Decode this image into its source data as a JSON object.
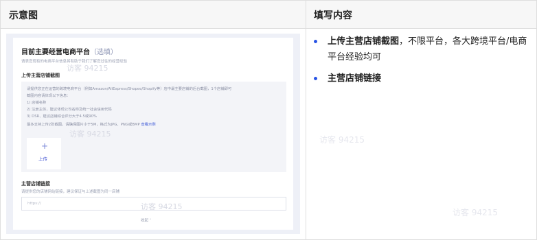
{
  "header": {
    "col1": "示意图",
    "col2": "填写内容"
  },
  "screenshot": {
    "title": "目前主要经营电商平台",
    "title_opt": "（选填）",
    "subtitle": "请表您现有的电商平台信息将有助于我们了解您过往的经营经验",
    "section1_title": "上传主营店铺截图",
    "instructions": [
      "请提供您正在运营的跨境电商平台（例如Amazon/AliExpress/Shopee/Shopify等）店中最主要店铺的后台截图，1个店铺即可",
      "截图内容请体现以下信息：",
      "1) 店铺名称",
      "2) 注册主体，建议体现公司名称及统一社会信用代码",
      "3) DSR、建议店铺综合评分大于4.5或90%",
      "最多支持上传2张截图，请确保图片小于5M，格式为JPG、PNG或BMP"
    ],
    "example_link": "查看示例",
    "upload_label": "上传",
    "section2_title": "主营店铺链接",
    "section2_sub": "请提供您的店铺网站链接，建议保证与上述截图为同一店铺",
    "input_placeholder": "https://",
    "collapse_label": "收起 ˄",
    "watermark": "访客 94215"
  },
  "content": {
    "item1_bold": "上传主营店铺截图",
    "item1_text": "，不限平台，各大跨境平台/电商平台经验均可",
    "item2_bold": "主营店铺链接"
  },
  "colors": {
    "accent": "#2a55e5",
    "link": "#3b57d6",
    "panel_bg": "#eef0f7"
  }
}
